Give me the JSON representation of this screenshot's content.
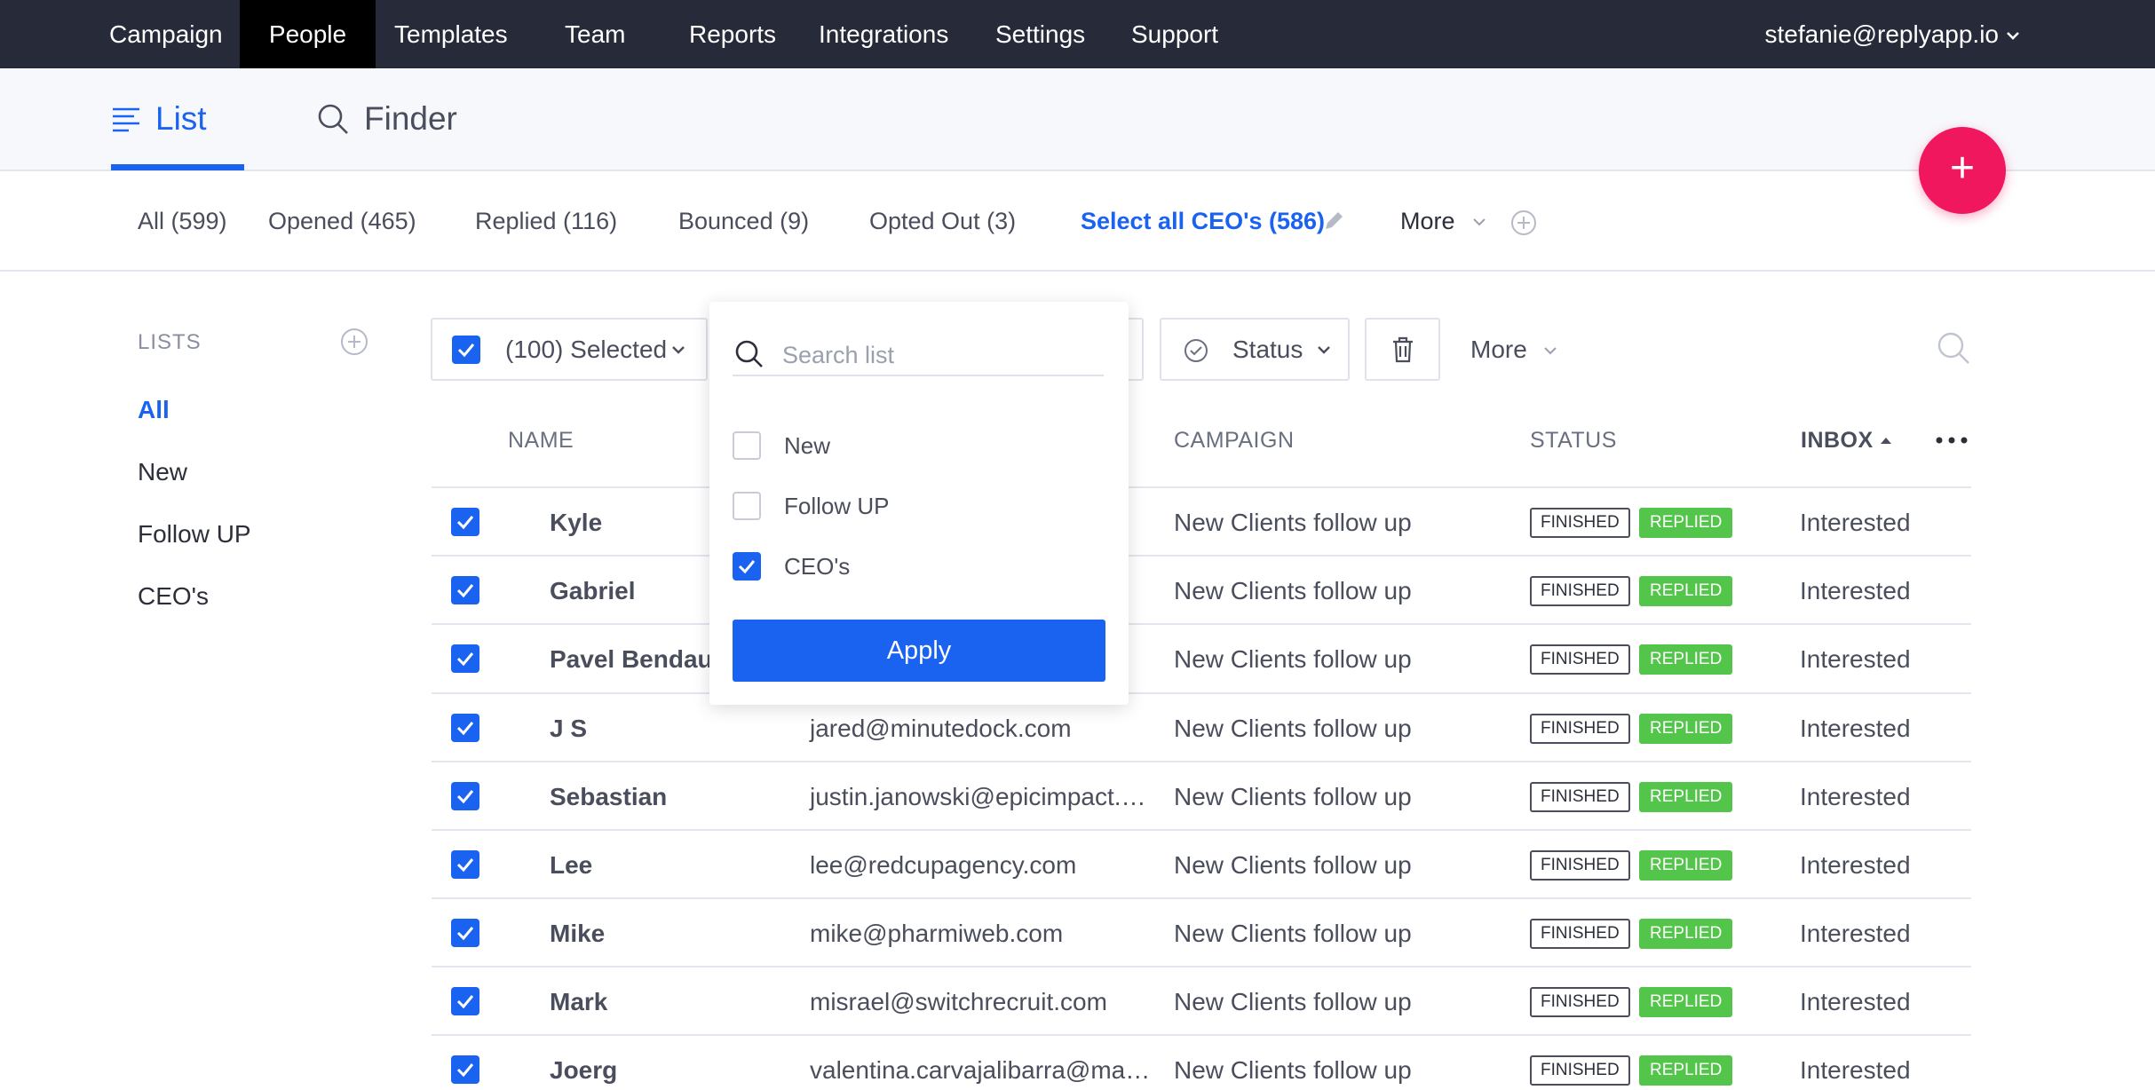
{
  "nav": {
    "items": [
      "Campaign",
      "People",
      "Templates",
      "Team",
      "Reports",
      "Integrations",
      "Settings",
      "Support"
    ],
    "active": "People",
    "user": "stefanie@replyapp.io"
  },
  "subtabs": {
    "list": "List",
    "finder": "Finder"
  },
  "fab": {
    "label": "+"
  },
  "filters": {
    "all": "All (599)",
    "opened": "Opened (465)",
    "replied": "Replied (116)",
    "bounced": "Bounced (9)",
    "opted_out": "Opted Out (3)",
    "select_all": "Select all CEO's (586)",
    "more": "More"
  },
  "sidebar": {
    "title": "LISTS",
    "items": [
      "All",
      "New",
      "Follow UP",
      "CEO's"
    ],
    "active": "All"
  },
  "toolbar": {
    "selected_label": "(100) Selected",
    "status_label": "Status",
    "more_label": "More"
  },
  "table": {
    "headers": {
      "name": "NAME",
      "campaign": "CAMPAIGN",
      "status": "STATUS",
      "inbox": "INBOX"
    },
    "rows": [
      {
        "name": "Kyle",
        "email": "",
        "campaign": "New Clients follow up",
        "status1": "FINISHED",
        "status2": "REPLIED",
        "inbox": "Interested"
      },
      {
        "name": "Gabriel",
        "email": "",
        "campaign": "New Clients follow up",
        "status1": "FINISHED",
        "status2": "REPLIED",
        "inbox": "Interested"
      },
      {
        "name": "Pavel Bendau",
        "email": "",
        "campaign": "New Clients follow up",
        "status1": "FINISHED",
        "status2": "REPLIED",
        "inbox": "Interested"
      },
      {
        "name": "J S",
        "email": "jared@minutedock.com",
        "campaign": "New Clients follow up",
        "status1": "FINISHED",
        "status2": "REPLIED",
        "inbox": "Interested"
      },
      {
        "name": "Sebastian",
        "email": "justin.janowski@epicimpact.…",
        "campaign": "New Clients follow up",
        "status1": "FINISHED",
        "status2": "REPLIED",
        "inbox": "Interested"
      },
      {
        "name": "Lee",
        "email": "lee@redcupagency.com",
        "campaign": "New Clients follow up",
        "status1": "FINISHED",
        "status2": "REPLIED",
        "inbox": "Interested"
      },
      {
        "name": "Mike",
        "email": "mike@pharmiweb.com",
        "campaign": "New Clients follow up",
        "status1": "FINISHED",
        "status2": "REPLIED",
        "inbox": "Interested"
      },
      {
        "name": "Mark",
        "email": "misrael@switchrecruit.com",
        "campaign": "New Clients follow up",
        "status1": "FINISHED",
        "status2": "REPLIED",
        "inbox": "Interested"
      },
      {
        "name": "Joerg",
        "email": "valentina.carvajalibarra@ma…",
        "campaign": "New Clients follow up",
        "status1": "FINISHED",
        "status2": "REPLIED",
        "inbox": "Interested"
      }
    ]
  },
  "dropdown": {
    "search_placeholder": "Search list",
    "options": [
      {
        "label": "New",
        "checked": false
      },
      {
        "label": "Follow UP",
        "checked": false
      },
      {
        "label": "CEO's",
        "checked": true
      }
    ],
    "apply_label": "Apply"
  },
  "colors": {
    "nav_bg": "#272a38",
    "accent": "#1a62f0",
    "fab": "#f0175f",
    "replied": "#54c54b"
  }
}
